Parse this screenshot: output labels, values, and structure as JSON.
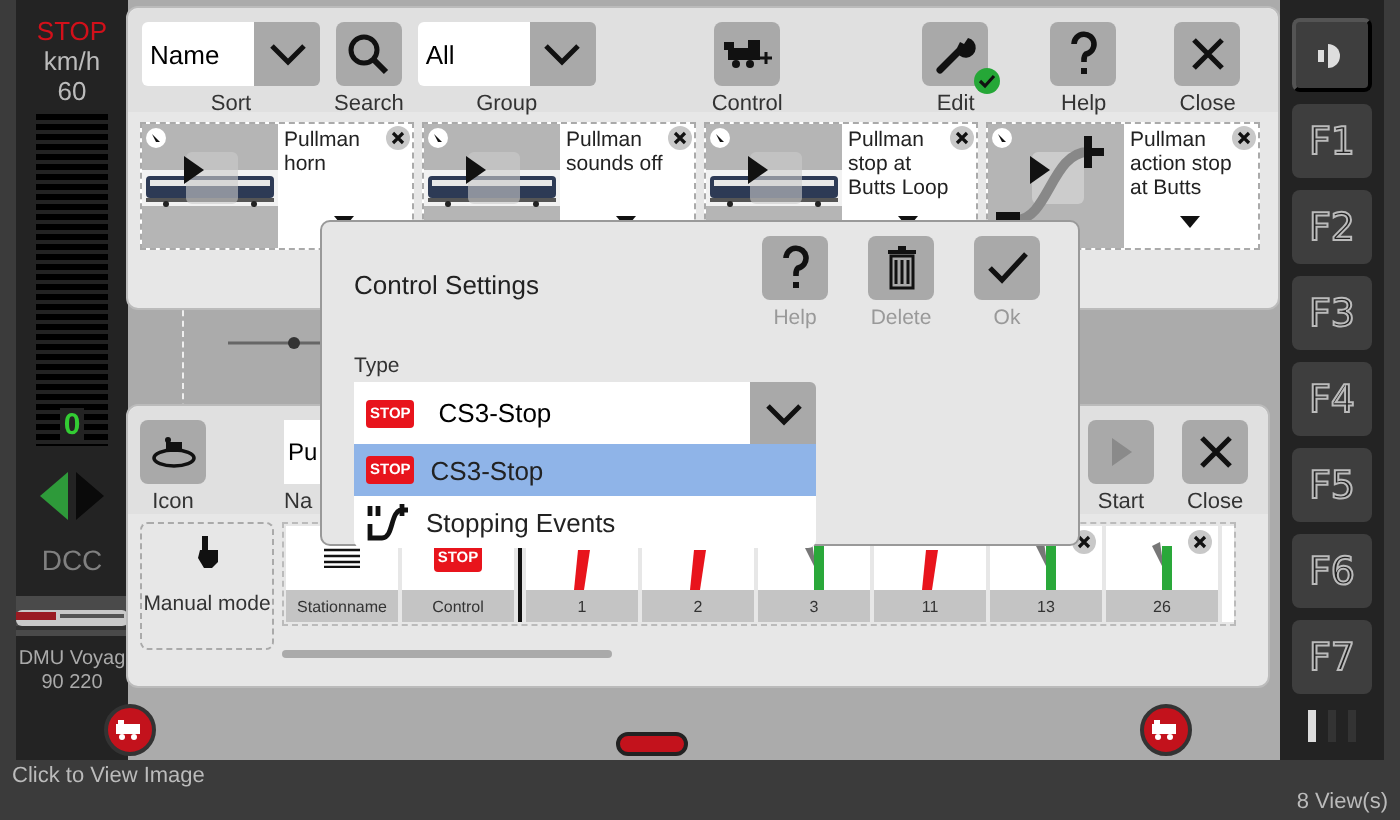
{
  "speed_panel": {
    "stop": "STOP",
    "unit": "km/h",
    "max": "60",
    "speed": "0",
    "level": 0,
    "arrows": [
      {
        "kind": "left",
        "selected": true
      },
      {
        "kind": "right",
        "selected": false
      }
    ],
    "protocol": "DCC",
    "loco_name": "DMU Voyag",
    "loco_address": "90 220"
  },
  "function_keys": [
    {
      "kind": "light"
    },
    {
      "kind": "key",
      "label": "F1"
    },
    {
      "kind": "key",
      "label": "F2"
    },
    {
      "kind": "key",
      "label": "F3"
    },
    {
      "kind": "key",
      "label": "F4"
    },
    {
      "kind": "key",
      "label": "F5"
    },
    {
      "kind": "key",
      "label": "F6"
    },
    {
      "kind": "key",
      "label": "F7"
    }
  ],
  "top_window": {
    "sort": {
      "value": "Name",
      "label": "Sort"
    },
    "search": {
      "label": "Search"
    },
    "group": {
      "value": "All",
      "label": "Group"
    },
    "tools": [
      {
        "kind": "control",
        "label": "Control"
      },
      {
        "kind": "edit",
        "label": "Edit",
        "checked": true
      },
      {
        "kind": "help",
        "label": "Help"
      },
      {
        "kind": "close",
        "label": "Close"
      }
    ],
    "cards": [
      {
        "kind": "video",
        "text": "Pullman horn"
      },
      {
        "kind": "video",
        "text": "Pullman sounds off"
      },
      {
        "kind": "video",
        "text": "Pullman stop at Butts Loop"
      },
      {
        "kind": "route",
        "text": "Pullman action stop at Butts"
      }
    ]
  },
  "bottom_window": {
    "icon_label": "Icon",
    "name_value": "Pu",
    "name_label": "Na",
    "start": {
      "label": "Start",
      "disabled": true
    },
    "close_label": "Close",
    "manual_mode": "Manual mode",
    "steps": [
      {
        "kind": "station",
        "label": "Stationname",
        "closable": false
      },
      {
        "kind": "stop",
        "badge": "STOP",
        "label": "Control",
        "closable": false
      },
      {
        "kind": "signal",
        "label": "1",
        "open": false,
        "color": "#e8141c",
        "closable": false
      },
      {
        "kind": "signal",
        "label": "2",
        "open": false,
        "color": "#e8141c",
        "closable": false
      },
      {
        "kind": "signal",
        "label": "3",
        "open": true,
        "color": "#2aa83a",
        "closable": false
      },
      {
        "kind": "signal",
        "label": "11",
        "open": false,
        "color": "#e8141c",
        "closable": false
      },
      {
        "kind": "signal",
        "label": "13",
        "open": true,
        "color": "#2aa83a",
        "closable": true
      },
      {
        "kind": "signal",
        "label": "26",
        "open": true,
        "color": "#2aa83a",
        "closable": true
      }
    ]
  },
  "dialog": {
    "title": "Control Settings",
    "buttons": [
      {
        "kind": "help",
        "label": "Help"
      },
      {
        "kind": "delete",
        "label": "Delete"
      },
      {
        "kind": "ok",
        "label": "Ok"
      }
    ],
    "type_label": "Type",
    "type_value": {
      "badge": "STOP",
      "label": "CS3-Stop"
    },
    "options": [
      {
        "kind": "stop",
        "badge": "STOP",
        "label": "CS3-Stop",
        "selected": true
      },
      {
        "kind": "events",
        "label": "Stopping Events",
        "selected": false
      }
    ]
  },
  "status_bar": {
    "left": "Click to View Image",
    "right": "8 View(s)"
  }
}
